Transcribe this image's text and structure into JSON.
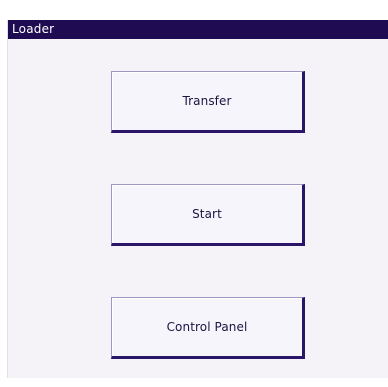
{
  "window": {
    "title": "Loader"
  },
  "buttons": {
    "transfer_label": "Transfer",
    "start_label": "Start",
    "control_panel_label": "Control Panel"
  },
  "colors": {
    "titlebar": "#1e0b52",
    "button_border": "#2a1668",
    "window_background": "#f5f3f8"
  }
}
